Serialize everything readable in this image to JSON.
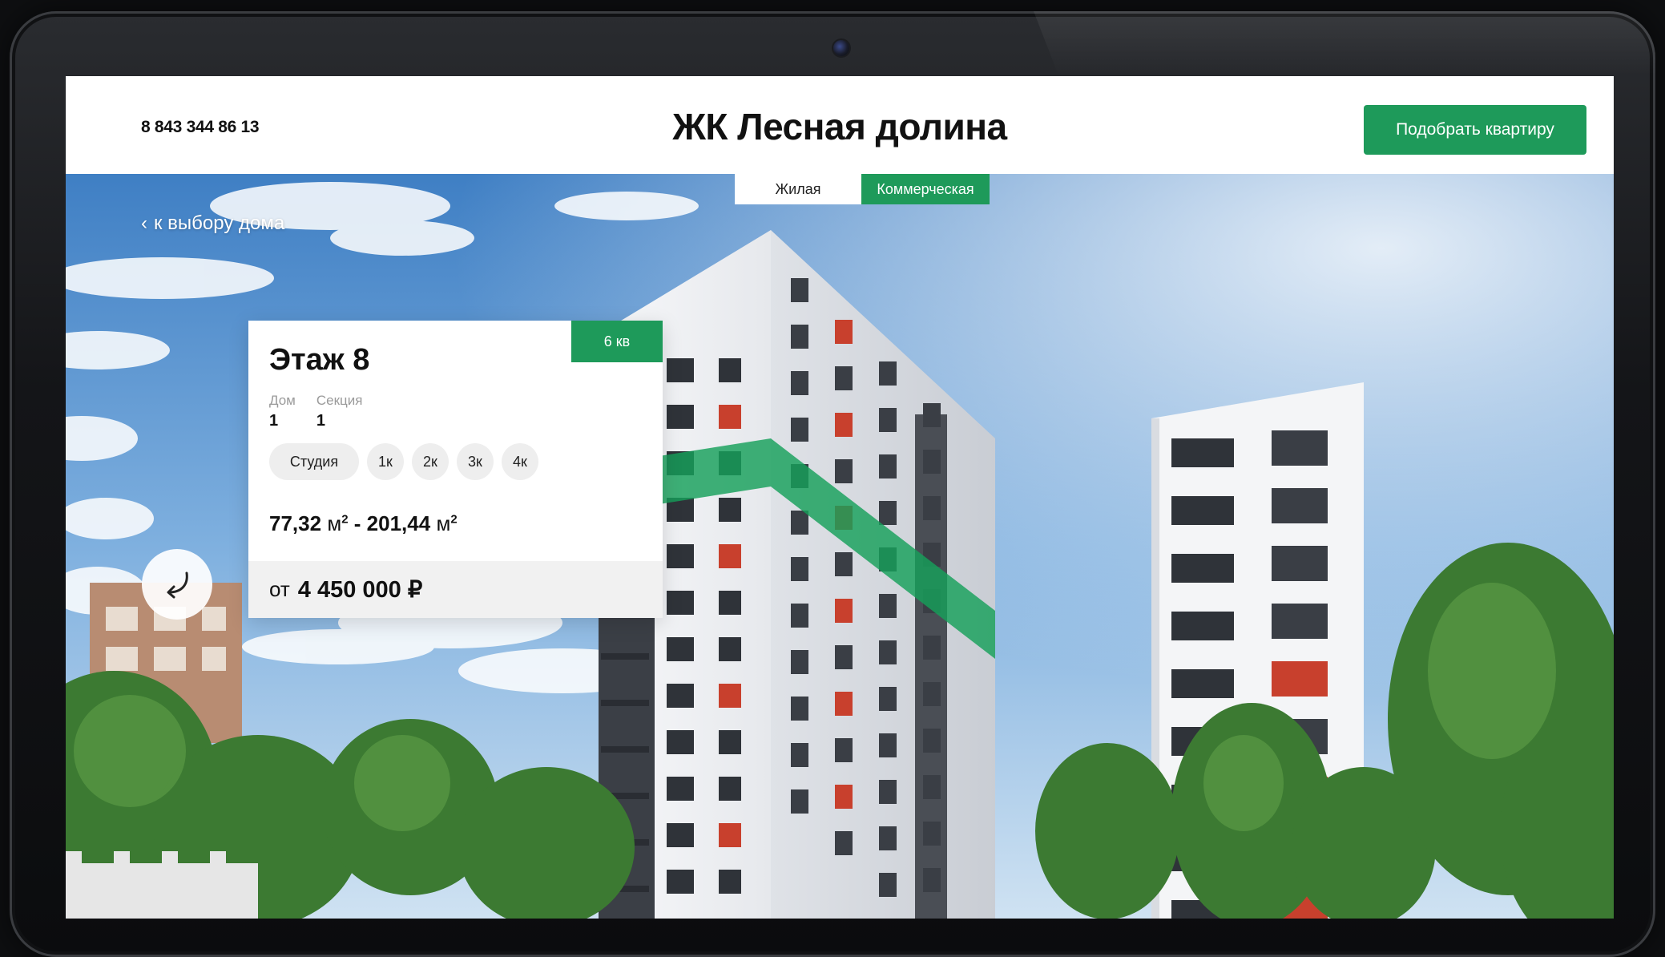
{
  "header": {
    "phone": "8 843 344 86 13",
    "title": "ЖК Лесная долина",
    "cta_label": "Подобрать квартиру"
  },
  "tabs": [
    {
      "label": "Жилая",
      "active": false
    },
    {
      "label": "Коммерческая",
      "active": true
    }
  ],
  "back_link": {
    "label": "к выбору дома",
    "icon": "chevron-left-icon"
  },
  "floor_card": {
    "badge": "6 кв",
    "title": "Этаж 8",
    "house_label": "Дом",
    "house_value": "1",
    "section_label": "Секция",
    "section_value": "1",
    "room_filters": [
      "Студия",
      "1к",
      "2к",
      "3к",
      "4к"
    ],
    "area_min": "77,32",
    "area_max": "201,44",
    "area_unit": "м",
    "area_sep": "-",
    "price_prefix": "от",
    "price_value": "4 450 000 ₽"
  },
  "rotate_button": {
    "icon": "rotate-arrow-icon"
  },
  "colors": {
    "accent": "#1e9a5a",
    "bezel": "#141518",
    "accent_panels": "#c8402d"
  }
}
